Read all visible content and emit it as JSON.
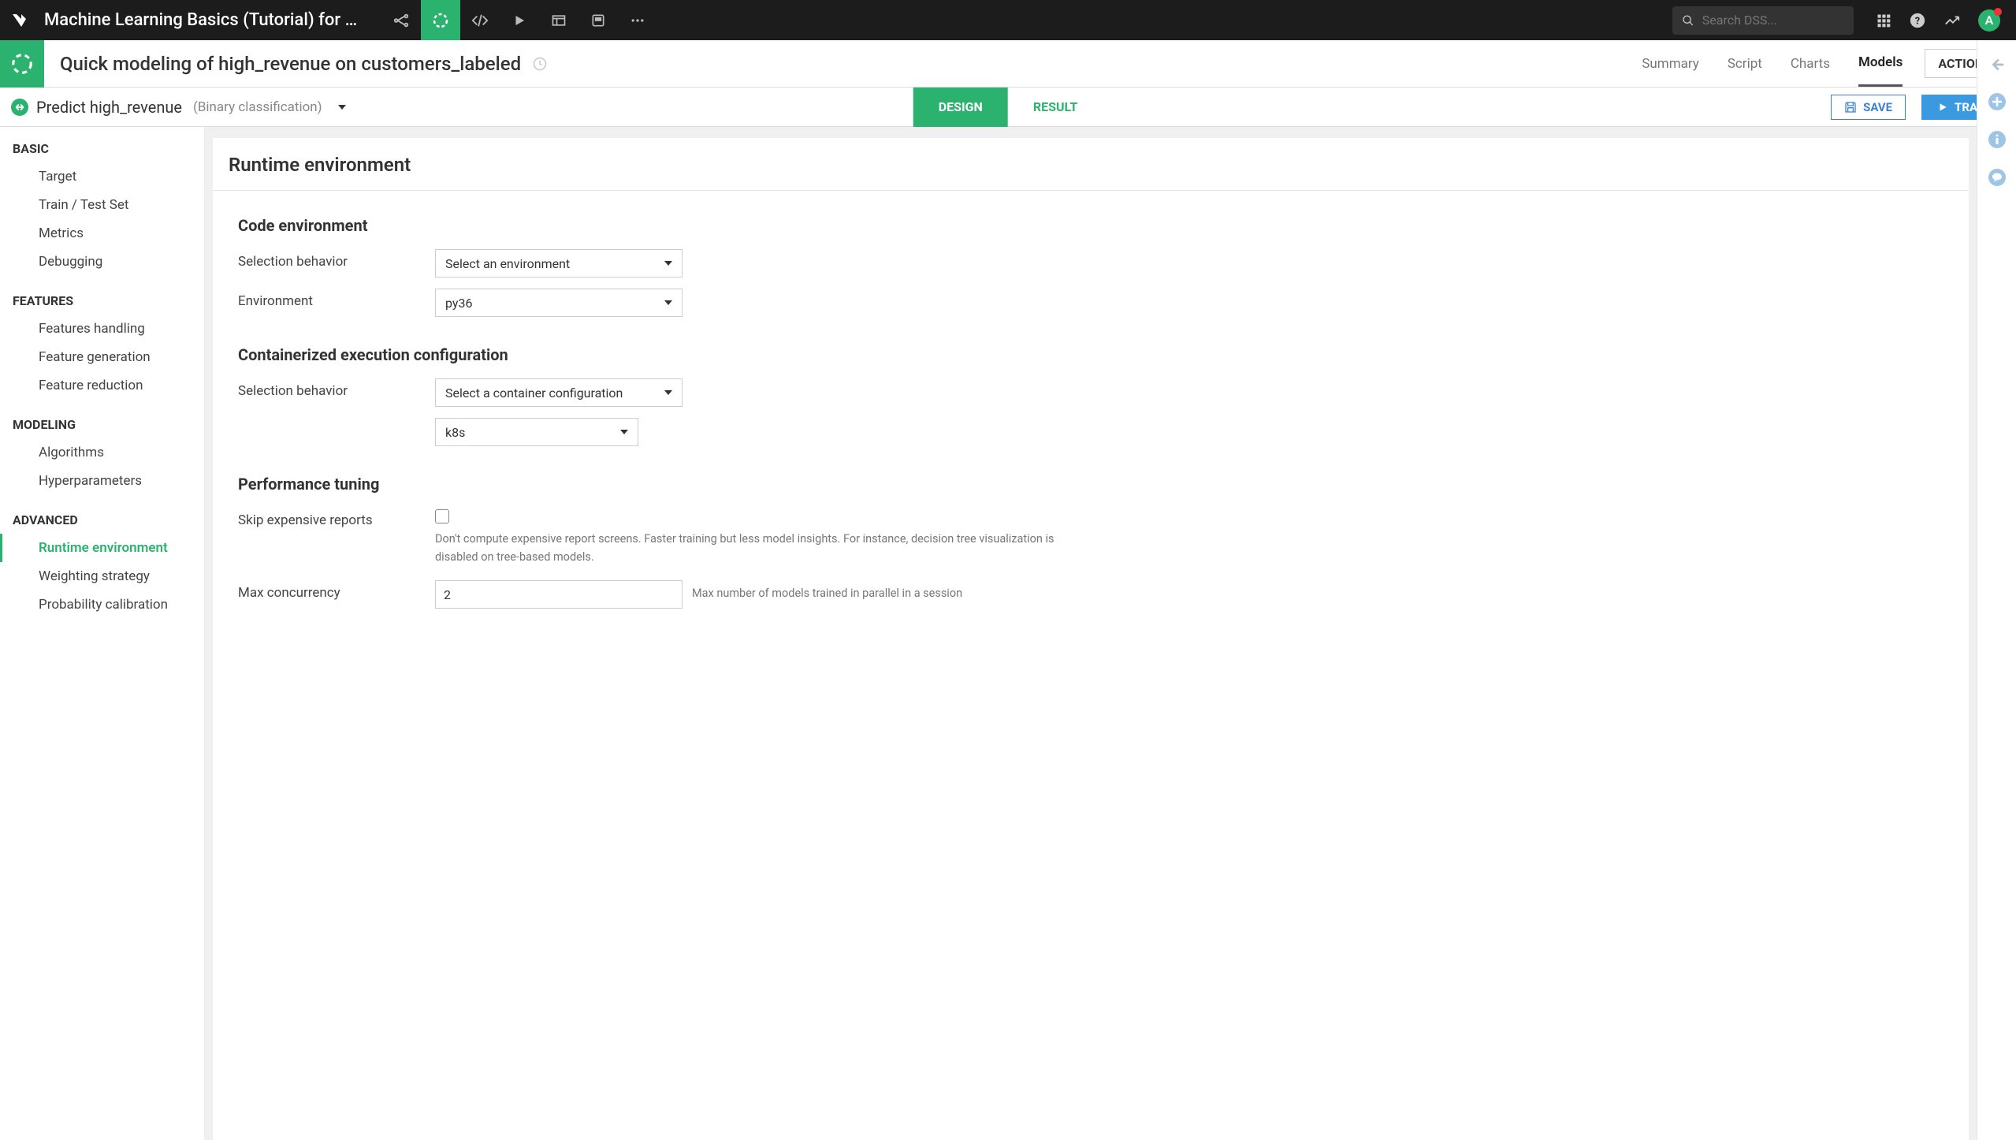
{
  "topbar": {
    "project_title": "Machine Learning Basics (Tutorial) for Adm…",
    "search_placeholder": "Search DSS...",
    "avatar_letter": "A"
  },
  "subbar": {
    "page_title": "Quick modeling of high_revenue on customers_labeled",
    "tabs": {
      "summary": "Summary",
      "script": "Script",
      "charts": "Charts",
      "models": "Models"
    },
    "actions": "ACTIONS"
  },
  "thirdbar": {
    "pred_title": "Predict high_revenue",
    "pred_sub": "(Binary classification)",
    "design": "DESIGN",
    "result": "RESULT",
    "save": "SAVE",
    "train": "TRAIN"
  },
  "sidebar": {
    "basic": {
      "header": "BASIC",
      "target": "Target",
      "train_test": "Train / Test Set",
      "metrics": "Metrics",
      "debugging": "Debugging"
    },
    "features": {
      "header": "FEATURES",
      "handling": "Features handling",
      "generation": "Feature generation",
      "reduction": "Feature reduction"
    },
    "modeling": {
      "header": "MODELING",
      "algorithms": "Algorithms",
      "hyper": "Hyperparameters"
    },
    "advanced": {
      "header": "ADVANCED",
      "runtime": "Runtime environment",
      "weighting": "Weighting strategy",
      "prob": "Probability calibration"
    }
  },
  "content": {
    "title": "Runtime environment",
    "code_env": {
      "title": "Code environment",
      "selection_label": "Selection behavior",
      "selection_value": "Select an environment",
      "env_label": "Environment",
      "env_value": "py36"
    },
    "container": {
      "title": "Containerized execution configuration",
      "selection_label": "Selection behavior",
      "selection_value": "Select a container configuration",
      "config_value": "k8s"
    },
    "perf": {
      "title": "Performance tuning",
      "skip_label": "Skip expensive reports",
      "skip_help": "Don't compute expensive report screens. Faster training but less model insights. For instance, decision tree visualization is disabled on tree-based models.",
      "max_label": "Max concurrency",
      "max_value": "2",
      "max_help": "Max number of models trained in parallel in a session"
    }
  }
}
